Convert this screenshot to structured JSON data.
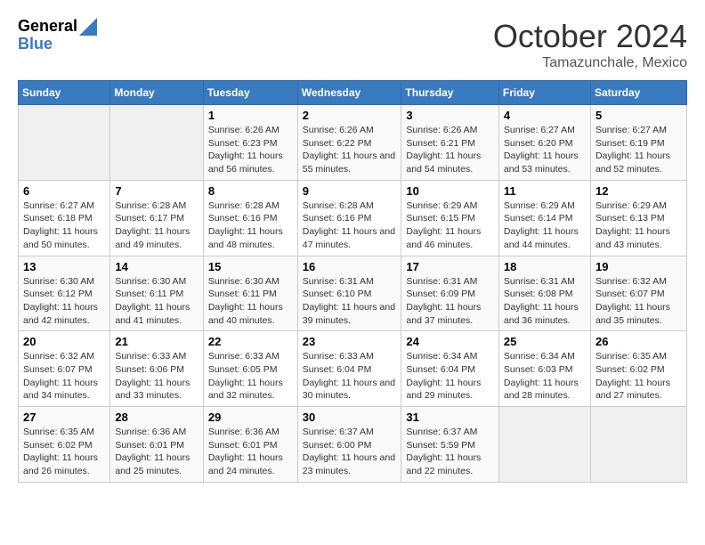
{
  "header": {
    "logo": {
      "general": "General",
      "blue": "Blue"
    },
    "month_title": "October 2024",
    "location": "Tamazunchale, Mexico"
  },
  "calendar": {
    "days_of_week": [
      "Sunday",
      "Monday",
      "Tuesday",
      "Wednesday",
      "Thursday",
      "Friday",
      "Saturday"
    ],
    "weeks": [
      [
        {
          "day": "",
          "sunrise": "",
          "sunset": "",
          "daylight": "",
          "empty": true
        },
        {
          "day": "",
          "sunrise": "",
          "sunset": "",
          "daylight": "",
          "empty": true
        },
        {
          "day": "1",
          "sunrise": "Sunrise: 6:26 AM",
          "sunset": "Sunset: 6:23 PM",
          "daylight": "Daylight: 11 hours and 56 minutes.",
          "empty": false
        },
        {
          "day": "2",
          "sunrise": "Sunrise: 6:26 AM",
          "sunset": "Sunset: 6:22 PM",
          "daylight": "Daylight: 11 hours and 55 minutes.",
          "empty": false
        },
        {
          "day": "3",
          "sunrise": "Sunrise: 6:26 AM",
          "sunset": "Sunset: 6:21 PM",
          "daylight": "Daylight: 11 hours and 54 minutes.",
          "empty": false
        },
        {
          "day": "4",
          "sunrise": "Sunrise: 6:27 AM",
          "sunset": "Sunset: 6:20 PM",
          "daylight": "Daylight: 11 hours and 53 minutes.",
          "empty": false
        },
        {
          "day": "5",
          "sunrise": "Sunrise: 6:27 AM",
          "sunset": "Sunset: 6:19 PM",
          "daylight": "Daylight: 11 hours and 52 minutes.",
          "empty": false
        }
      ],
      [
        {
          "day": "6",
          "sunrise": "Sunrise: 6:27 AM",
          "sunset": "Sunset: 6:18 PM",
          "daylight": "Daylight: 11 hours and 50 minutes.",
          "empty": false
        },
        {
          "day": "7",
          "sunrise": "Sunrise: 6:28 AM",
          "sunset": "Sunset: 6:17 PM",
          "daylight": "Daylight: 11 hours and 49 minutes.",
          "empty": false
        },
        {
          "day": "8",
          "sunrise": "Sunrise: 6:28 AM",
          "sunset": "Sunset: 6:16 PM",
          "daylight": "Daylight: 11 hours and 48 minutes.",
          "empty": false
        },
        {
          "day": "9",
          "sunrise": "Sunrise: 6:28 AM",
          "sunset": "Sunset: 6:16 PM",
          "daylight": "Daylight: 11 hours and 47 minutes.",
          "empty": false
        },
        {
          "day": "10",
          "sunrise": "Sunrise: 6:29 AM",
          "sunset": "Sunset: 6:15 PM",
          "daylight": "Daylight: 11 hours and 46 minutes.",
          "empty": false
        },
        {
          "day": "11",
          "sunrise": "Sunrise: 6:29 AM",
          "sunset": "Sunset: 6:14 PM",
          "daylight": "Daylight: 11 hours and 44 minutes.",
          "empty": false
        },
        {
          "day": "12",
          "sunrise": "Sunrise: 6:29 AM",
          "sunset": "Sunset: 6:13 PM",
          "daylight": "Daylight: 11 hours and 43 minutes.",
          "empty": false
        }
      ],
      [
        {
          "day": "13",
          "sunrise": "Sunrise: 6:30 AM",
          "sunset": "Sunset: 6:12 PM",
          "daylight": "Daylight: 11 hours and 42 minutes.",
          "empty": false
        },
        {
          "day": "14",
          "sunrise": "Sunrise: 6:30 AM",
          "sunset": "Sunset: 6:11 PM",
          "daylight": "Daylight: 11 hours and 41 minutes.",
          "empty": false
        },
        {
          "day": "15",
          "sunrise": "Sunrise: 6:30 AM",
          "sunset": "Sunset: 6:11 PM",
          "daylight": "Daylight: 11 hours and 40 minutes.",
          "empty": false
        },
        {
          "day": "16",
          "sunrise": "Sunrise: 6:31 AM",
          "sunset": "Sunset: 6:10 PM",
          "daylight": "Daylight: 11 hours and 39 minutes.",
          "empty": false
        },
        {
          "day": "17",
          "sunrise": "Sunrise: 6:31 AM",
          "sunset": "Sunset: 6:09 PM",
          "daylight": "Daylight: 11 hours and 37 minutes.",
          "empty": false
        },
        {
          "day": "18",
          "sunrise": "Sunrise: 6:31 AM",
          "sunset": "Sunset: 6:08 PM",
          "daylight": "Daylight: 11 hours and 36 minutes.",
          "empty": false
        },
        {
          "day": "19",
          "sunrise": "Sunrise: 6:32 AM",
          "sunset": "Sunset: 6:07 PM",
          "daylight": "Daylight: 11 hours and 35 minutes.",
          "empty": false
        }
      ],
      [
        {
          "day": "20",
          "sunrise": "Sunrise: 6:32 AM",
          "sunset": "Sunset: 6:07 PM",
          "daylight": "Daylight: 11 hours and 34 minutes.",
          "empty": false
        },
        {
          "day": "21",
          "sunrise": "Sunrise: 6:33 AM",
          "sunset": "Sunset: 6:06 PM",
          "daylight": "Daylight: 11 hours and 33 minutes.",
          "empty": false
        },
        {
          "day": "22",
          "sunrise": "Sunrise: 6:33 AM",
          "sunset": "Sunset: 6:05 PM",
          "daylight": "Daylight: 11 hours and 32 minutes.",
          "empty": false
        },
        {
          "day": "23",
          "sunrise": "Sunrise: 6:33 AM",
          "sunset": "Sunset: 6:04 PM",
          "daylight": "Daylight: 11 hours and 30 minutes.",
          "empty": false
        },
        {
          "day": "24",
          "sunrise": "Sunrise: 6:34 AM",
          "sunset": "Sunset: 6:04 PM",
          "daylight": "Daylight: 11 hours and 29 minutes.",
          "empty": false
        },
        {
          "day": "25",
          "sunrise": "Sunrise: 6:34 AM",
          "sunset": "Sunset: 6:03 PM",
          "daylight": "Daylight: 11 hours and 28 minutes.",
          "empty": false
        },
        {
          "day": "26",
          "sunrise": "Sunrise: 6:35 AM",
          "sunset": "Sunset: 6:02 PM",
          "daylight": "Daylight: 11 hours and 27 minutes.",
          "empty": false
        }
      ],
      [
        {
          "day": "27",
          "sunrise": "Sunrise: 6:35 AM",
          "sunset": "Sunset: 6:02 PM",
          "daylight": "Daylight: 11 hours and 26 minutes.",
          "empty": false
        },
        {
          "day": "28",
          "sunrise": "Sunrise: 6:36 AM",
          "sunset": "Sunset: 6:01 PM",
          "daylight": "Daylight: 11 hours and 25 minutes.",
          "empty": false
        },
        {
          "day": "29",
          "sunrise": "Sunrise: 6:36 AM",
          "sunset": "Sunset: 6:01 PM",
          "daylight": "Daylight: 11 hours and 24 minutes.",
          "empty": false
        },
        {
          "day": "30",
          "sunrise": "Sunrise: 6:37 AM",
          "sunset": "Sunset: 6:00 PM",
          "daylight": "Daylight: 11 hours and 23 minutes.",
          "empty": false
        },
        {
          "day": "31",
          "sunrise": "Sunrise: 6:37 AM",
          "sunset": "Sunset: 5:59 PM",
          "daylight": "Daylight: 11 hours and 22 minutes.",
          "empty": false
        },
        {
          "day": "",
          "sunrise": "",
          "sunset": "",
          "daylight": "",
          "empty": true
        },
        {
          "day": "",
          "sunrise": "",
          "sunset": "",
          "daylight": "",
          "empty": true
        }
      ]
    ]
  }
}
